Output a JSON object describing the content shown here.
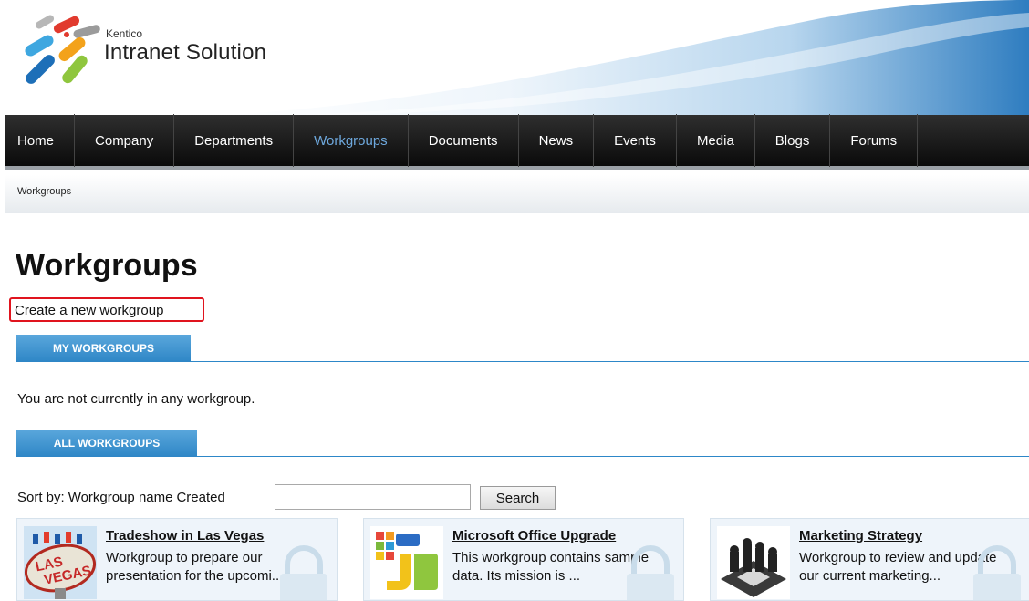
{
  "brand": {
    "small": "Kentico",
    "name": "Intranet Solution"
  },
  "nav": {
    "items": [
      "Home",
      "Company",
      "Departments",
      "Workgroups",
      "Documents",
      "News",
      "Events",
      "Media",
      "Blogs",
      "Forums"
    ],
    "active": "Workgroups"
  },
  "breadcrumb": "Workgroups",
  "page": {
    "title": "Workgroups",
    "create_link": "Create a new workgroup",
    "my_tab": "MY WORKGROUPS",
    "empty_message": "You are not currently in any workgroup.",
    "all_tab": "ALL WORKGROUPS"
  },
  "sort": {
    "label": "Sort by:",
    "by_name": "Workgroup name",
    "by_created": "Created",
    "search_value": "",
    "search_button": "Search"
  },
  "cards": [
    {
      "title": "Tradeshow in Las Vegas",
      "description": "Workgroup to prepare our presentation for the upcomi...",
      "icon": "las-vegas-sign-image"
    },
    {
      "title": "Microsoft Office Upgrade",
      "description": "This workgroup contains sample data. Its mission is ...",
      "icon": "office-logo-image"
    },
    {
      "title": "Marketing Strategy",
      "description": "Workgroup to review and update our current marketing...",
      "icon": "chess-pieces-image"
    }
  ],
  "colors": {
    "accent": "#2e86c6",
    "nav_active": "#6ea8dd",
    "highlight": "#e0141e"
  }
}
